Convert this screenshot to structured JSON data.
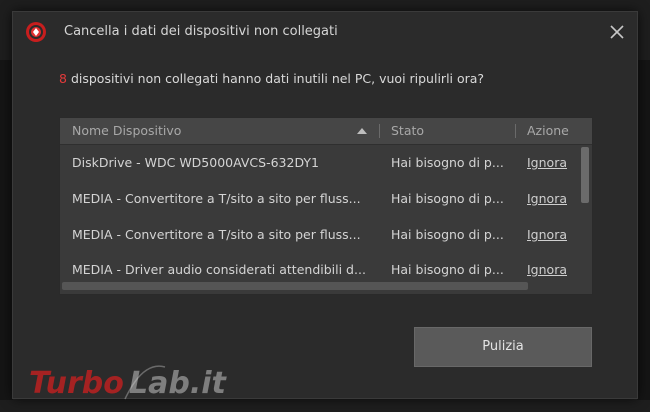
{
  "dialog": {
    "title": "Cancella i dati dei dispositivi non collegati",
    "message_count": "8",
    "message_text": "dispositivi non collegati hanno dati inutili nel PC, vuoi ripulirli ora?"
  },
  "table": {
    "columns": {
      "name": "Nome Dispositivo",
      "status": "Stato",
      "action": "Azione"
    },
    "rows": [
      {
        "name": "DiskDrive - WDC WD5000AVCS-632DY1",
        "status": "Hai bisogno di p...",
        "action": "Ignora"
      },
      {
        "name": "MEDIA - Convertitore a T/sito a sito per fluss...",
        "status": "Hai bisogno di p...",
        "action": "Ignora"
      },
      {
        "name": "MEDIA - Convertitore a T/sito a sito per fluss...",
        "status": "Hai bisogno di p...",
        "action": "Ignora"
      },
      {
        "name": "MEDIA - Driver audio considerati attendibili d...",
        "status": "Hai bisogno di p...",
        "action": "Ignora"
      }
    ]
  },
  "buttons": {
    "clean": "Pulizia"
  },
  "watermark": {
    "text_a": "Turbo",
    "text_b": "Lab.it"
  },
  "colors": {
    "accent_red": "#e23a3a",
    "dialog_bg": "#2b2b2b",
    "table_bg": "#3a3a3a"
  },
  "icons": {
    "app": "advanced-systemcare-icon",
    "close": "close-icon"
  }
}
